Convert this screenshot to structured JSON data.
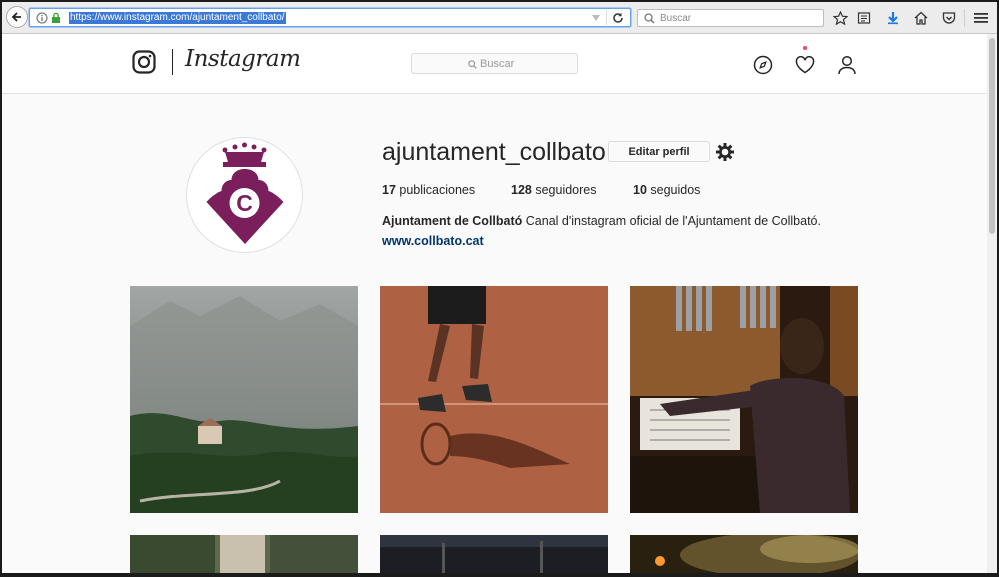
{
  "browser": {
    "url": "https://www.instagram.com/ajuntament_collbato/",
    "search_placeholder": "Buscar"
  },
  "instagram": {
    "wordmark": "Instagram",
    "search_placeholder": "Buscar"
  },
  "profile": {
    "username": "ajuntament_collbato",
    "edit_button": "Editar perfil",
    "stats": [
      {
        "count": "17",
        "label": "publicaciones"
      },
      {
        "count": "128",
        "label": "seguidores"
      },
      {
        "count": "10",
        "label": "seguidos"
      }
    ],
    "full_name": "Ajuntament de Collbató",
    "bio": "Canal d'instagram oficial de l'Ajuntament de Collbató.",
    "website": "www.collbato.cat",
    "avatar_letter": "C",
    "brand_color": "#7a1f5c"
  },
  "icons": [
    "back-arrow-icon",
    "info-icon",
    "lock-icon",
    "dropdown-icon",
    "reload-icon",
    "search-icon",
    "star-icon",
    "reading-list-icon",
    "download-icon",
    "home-icon",
    "pocket-icon",
    "menu-icon",
    "instagram-camera-icon",
    "compass-icon",
    "heart-icon",
    "user-icon",
    "gear-icon"
  ],
  "posts": [
    {
      "alt": "foggy mountain hermitage"
    },
    {
      "alt": "tennis player on clay court"
    },
    {
      "alt": "organ player"
    },
    {
      "alt": "street with trees"
    },
    {
      "alt": "night street"
    },
    {
      "alt": "night fireworks smoke"
    }
  ]
}
